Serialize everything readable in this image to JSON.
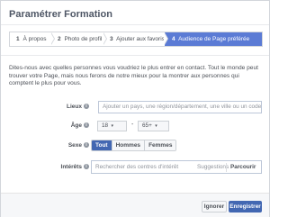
{
  "dialog": {
    "title": "Paramétrer Formation"
  },
  "steps": [
    {
      "num": "1",
      "label": "À propos"
    },
    {
      "num": "2",
      "label": "Photo de profil"
    },
    {
      "num": "3",
      "label": "Ajouter aux favoris"
    },
    {
      "num": "4",
      "label": "Audience de Page préférée"
    }
  ],
  "description": "Dites-nous avec quelles personnes vous voudriez le plus entrer en contact. Tout le monde peut trouver votre Page, mais nous ferons de notre mieux pour la montrer aux personnes qui comptent le plus pour vous.",
  "location": {
    "label": "Lieux",
    "placeholder": "Ajouter un pays, une région/département, une ville ou un code p"
  },
  "age": {
    "label": "Âge",
    "min": "18",
    "max": "65+",
    "separator": "-"
  },
  "gender": {
    "label": "Sexe",
    "options": [
      "Tout",
      "Hommes",
      "Femmes"
    ],
    "selected": "Tout"
  },
  "interests": {
    "label": "Intérêts",
    "placeholder": "Rechercher des centres d'intérêt",
    "suggestions": "Suggestions",
    "browse": "Parcourir"
  },
  "footer": {
    "ignore": "Ignorer",
    "save": "Enregistrer"
  },
  "icons": {
    "info": "info-icon",
    "caret": "caret-down-icon"
  },
  "colors": {
    "accent": "#4267b2",
    "active_step": "#5b7bd5"
  }
}
